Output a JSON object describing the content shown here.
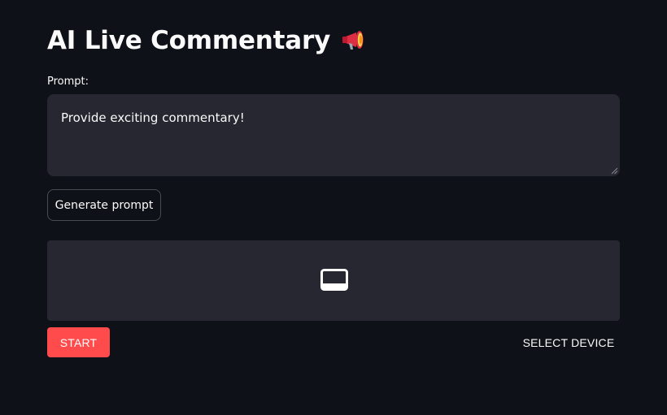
{
  "page": {
    "title": "AI Live Commentary",
    "title_emoji_icon": "megaphone-icon"
  },
  "prompt": {
    "label": "Prompt:",
    "value": "Provide exciting commentary!"
  },
  "generate_button": {
    "label": "Generate prompt"
  },
  "video": {
    "icon": "video-display-icon"
  },
  "controls": {
    "start_label": "START",
    "select_device_label": "SELECT DEVICE"
  },
  "colors": {
    "background": "#0e1117",
    "panel": "#262730",
    "accent": "#ff4b4b",
    "text": "#fafafa"
  }
}
